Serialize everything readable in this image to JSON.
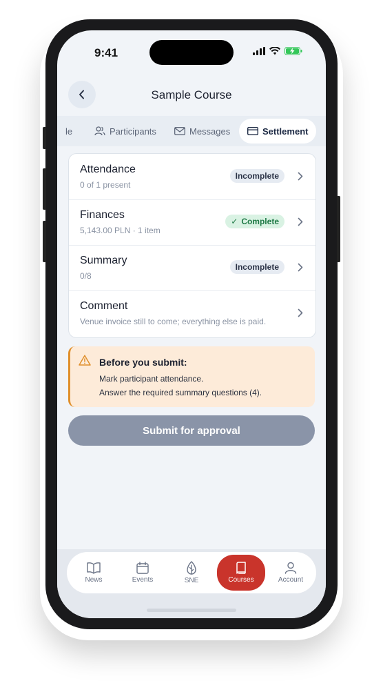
{
  "status": {
    "time": "9:41"
  },
  "header": {
    "title": "Sample Course",
    "back_icon": "chevron-left-icon"
  },
  "tabs": [
    {
      "label": "le",
      "icon": ""
    },
    {
      "label": "Participants",
      "icon": "users-icon"
    },
    {
      "label": "Messages",
      "icon": "mail-icon"
    },
    {
      "label": "Settlement",
      "icon": "card-icon",
      "active": true
    }
  ],
  "rows": [
    {
      "title": "Attendance",
      "subtitle": "0 of 1 present",
      "badge": "Incomplete",
      "status": "incomplete"
    },
    {
      "title": "Finances",
      "subtitle": "5,143.00 PLN · 1 item",
      "badge": "Complete",
      "badge_check": "✓",
      "status": "complete"
    },
    {
      "title": "Summary",
      "subtitle": "0/8",
      "badge": "Incomplete",
      "status": "incomplete"
    },
    {
      "title": "Comment",
      "subtitle": "Venue invoice still to come; everything else is paid."
    }
  ],
  "warning": {
    "title": "Before you submit:",
    "lines": [
      "Mark participant attendance.",
      "Answer the required summary questions (4)."
    ]
  },
  "submit_label": "Submit for approval",
  "nav": [
    {
      "label": "News",
      "icon": "book-open-icon"
    },
    {
      "label": "Events",
      "icon": "calendar-icon"
    },
    {
      "label": "SNE",
      "icon": "leaf-icon"
    },
    {
      "label": "Courses",
      "icon": "book-icon",
      "active": true
    },
    {
      "label": "Account",
      "icon": "user-icon"
    }
  ],
  "colors": {
    "accent": "#c9342b",
    "complete_bg": "#d9f2e3",
    "warning_bg": "#fdebd9",
    "warning_border": "#e0902c",
    "submit_bg": "#8a94a8"
  }
}
